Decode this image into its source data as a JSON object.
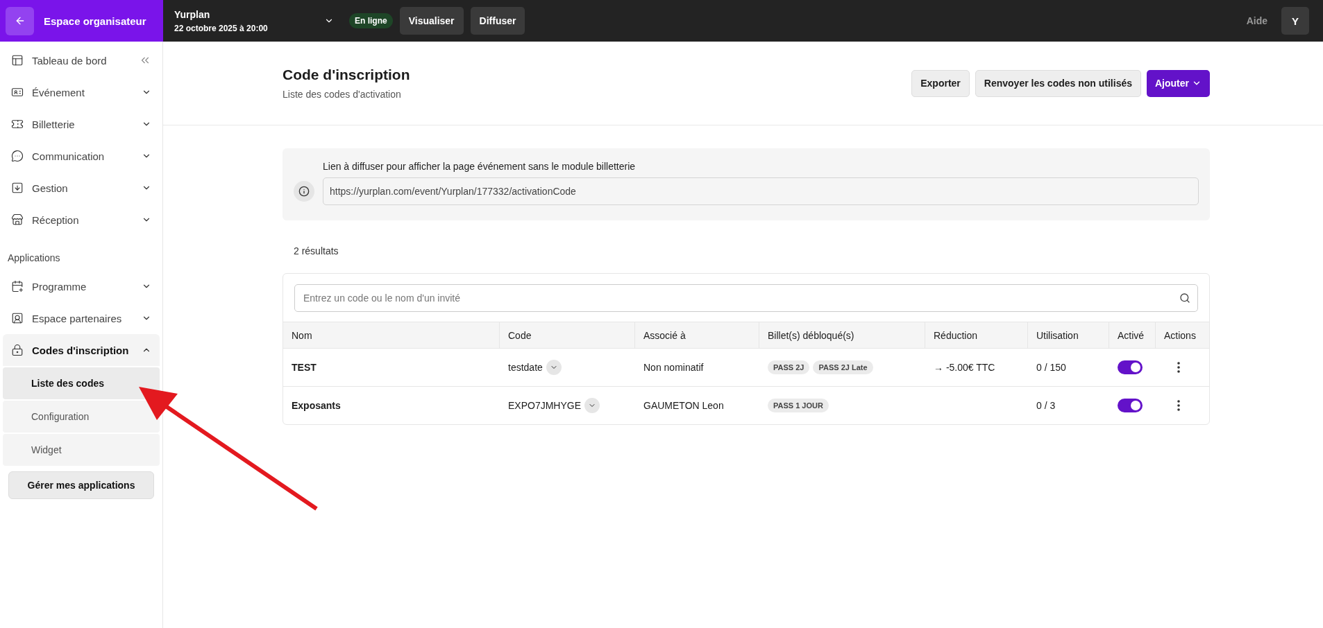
{
  "topbar": {
    "back_label": "Espace organisateur",
    "event_name": "Yurplan",
    "event_date": "22 octobre 2025 à 20:00",
    "status": "En ligne",
    "buttons": [
      "Visualiser",
      "Diffuser"
    ],
    "help": "Aide",
    "avatar": "Y"
  },
  "sidebar": {
    "sections": [
      {
        "items": [
          {
            "label": "Tableau de bord",
            "kind": "link"
          },
          {
            "label": "Événement",
            "kind": "group",
            "expanded": false
          },
          {
            "label": "Billetterie",
            "kind": "group",
            "expanded": false
          },
          {
            "label": "Communication",
            "kind": "group",
            "expanded": false
          },
          {
            "label": "Gestion",
            "kind": "group",
            "expanded": false
          },
          {
            "label": "Réception",
            "kind": "group",
            "expanded": false
          }
        ]
      },
      {
        "title": "Applications",
        "items": [
          {
            "label": "Programme",
            "kind": "group",
            "expanded": false
          },
          {
            "label": "Espace partenaires",
            "kind": "group",
            "expanded": false
          },
          {
            "label": "Codes d'inscription",
            "kind": "group",
            "expanded": true,
            "children": [
              {
                "label": "Liste des codes",
                "selected": true
              },
              {
                "label": "Configuration",
                "selected": false
              },
              {
                "label": "Widget",
                "selected": false
              }
            ]
          }
        ]
      }
    ],
    "manage_button": "Gérer mes applications"
  },
  "header": {
    "title": "Code d'inscription",
    "subtitle": "Liste des codes d'activation",
    "buttons": [
      {
        "label": "Exporter",
        "kind": "secondary"
      },
      {
        "label": "Renvoyer les codes non utilisés",
        "kind": "secondary"
      },
      {
        "label": "Ajouter",
        "kind": "primary"
      }
    ]
  },
  "share": {
    "label": "Lien à diffuser pour afficher la page événement sans le module billetterie",
    "url": "https://yurplan.com/event/Yurplan/177332/activationCode"
  },
  "results": "2 résultats",
  "table": {
    "search": {
      "placeholder": "Entrez un code ou le nom d'un invité"
    },
    "columns": [
      "Nom",
      "Code",
      "Associé à",
      "Billet(s) débloqué(s)",
      "Réduction",
      "Utilisation",
      "Activé",
      "Actions"
    ],
    "rows": [
      {
        "name": "TEST",
        "code": "testdate",
        "associated": "Non nominatif",
        "tickets": [
          "PASS 2J",
          "PASS 2J Late"
        ],
        "reduction": "→ -5.00€ TTC",
        "usage": "0 / 150",
        "active": true
      },
      {
        "name": "Exposants",
        "code": "EXPO7JMHYGE",
        "associated": "GAUMETON Leon",
        "tickets": [
          "PASS 1 JOUR"
        ],
        "usage": "0 / 3",
        "active": true
      }
    ]
  }
}
